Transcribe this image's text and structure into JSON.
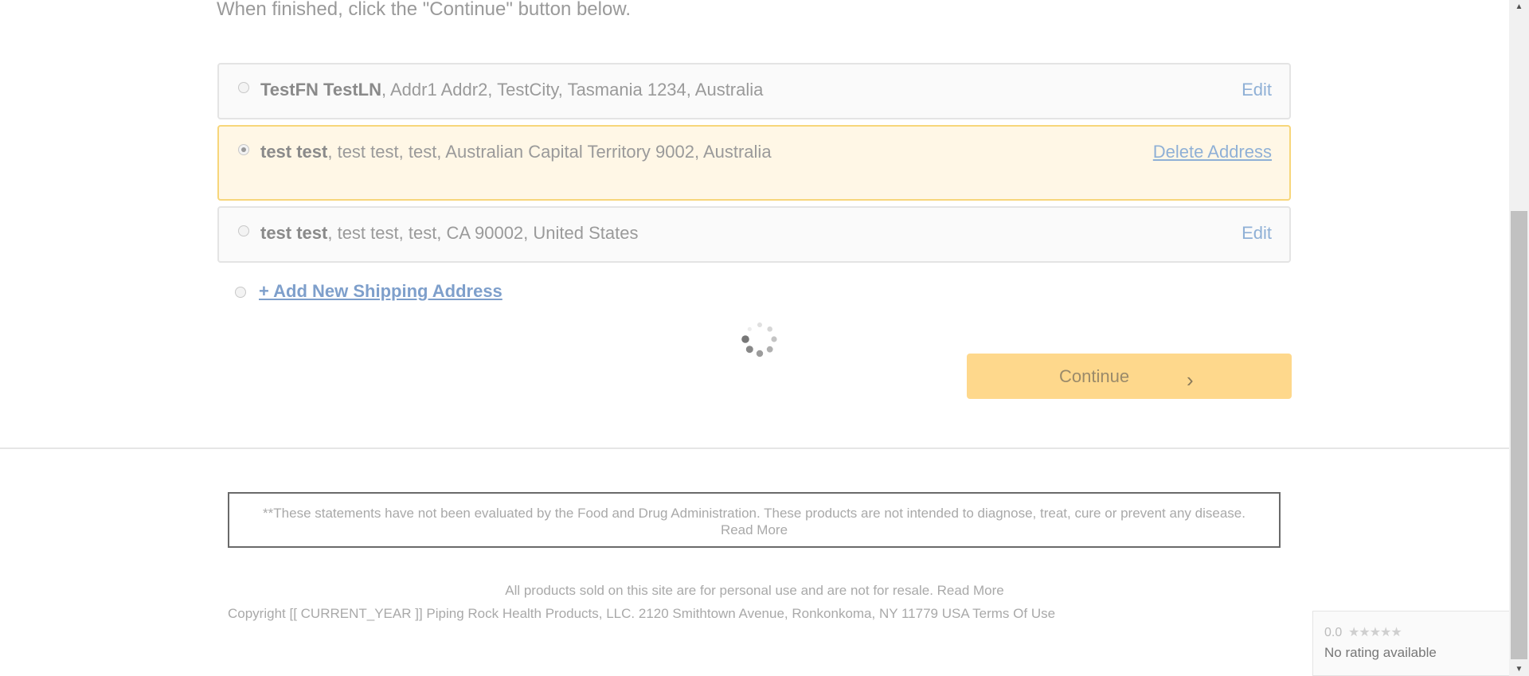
{
  "instructions": "When finished, click the \"Continue\" button below.",
  "addresses": [
    {
      "name": "TestFN TestLN",
      "details": ", Addr1 Addr2, TestCity, Tasmania 1234, Australia",
      "action": "Edit",
      "selected": false
    },
    {
      "name": "test test",
      "details": ", test test, test, Australian Capital Territory 9002, Australia",
      "action": "Delete Address",
      "selected": true
    },
    {
      "name": "test test",
      "details": ", test test, test, CA 90002, United States",
      "action": "Edit",
      "selected": false
    }
  ],
  "add_new_label": "+ Add New Shipping Address",
  "continue_label": "Continue",
  "continue_chevron": "›",
  "disclaimer": "**These statements have not been evaluated by the Food and Drug Administration. These products are not intended to diagnose, treat, cure or prevent any disease. Read More",
  "footer": {
    "line1": "All products sold on this site are for personal use and are not for resale. Read More",
    "line2": "Copyright [[ CURRENT_YEAR ]] Piping Rock Health Products, LLC. 2120 Smithtown Avenue, Ronkonkoma, NY 11779 USA Terms Of Use"
  },
  "rating": {
    "score": "0.0",
    "stars": "★★★★★",
    "label": "No rating available"
  },
  "colors": {
    "selected_bg": "#fff7e6",
    "selected_border": "#f7d67a",
    "button_bg": "#fed88c",
    "link": "#7e9fcb"
  }
}
